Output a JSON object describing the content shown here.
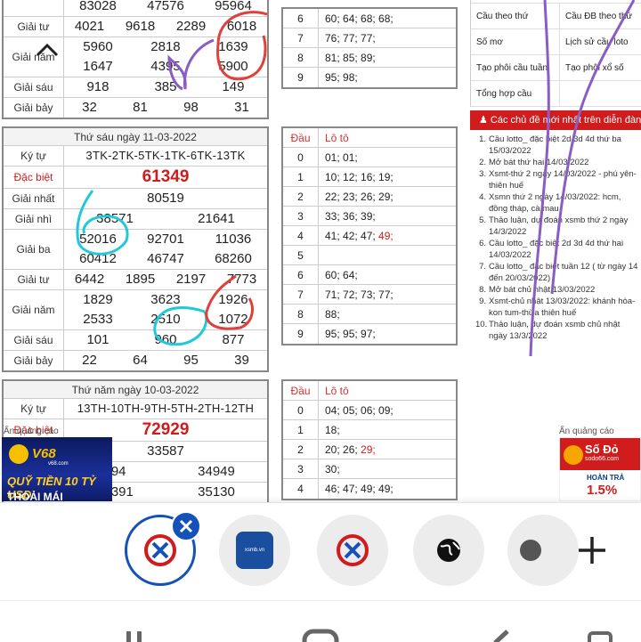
{
  "table1": {
    "rows": [
      {
        "label": "",
        "nums": [
          "83028",
          "47576",
          "95964"
        ]
      },
      {
        "label": "Giải tư",
        "nums": [
          "4021",
          "9618",
          "2289",
          "6018"
        ]
      },
      {
        "label": "Giải năm",
        "nums": [
          "5960",
          "2818",
          "1639",
          "1647",
          "4395",
          "5900"
        ]
      },
      {
        "label": "Giải sáu",
        "nums": [
          "918",
          "385",
          "149"
        ]
      },
      {
        "label": "Giải bảy",
        "nums": [
          "32",
          "81",
          "98",
          "31"
        ]
      }
    ]
  },
  "loto1": {
    "rows": [
      {
        "dau": "6",
        "lt": "60; 64; 68; 68;"
      },
      {
        "dau": "7",
        "lt": "76; 77; 77;"
      },
      {
        "dau": "8",
        "lt": "81; 85; 89;"
      },
      {
        "dau": "9",
        "lt": "95; 98;"
      }
    ]
  },
  "table2": {
    "caption": "Thứ sáu ngày 11-03-2022",
    "ky_tu_label": "Ký tự",
    "ky_tu": "3TK-2TK-5TK-1TK-6TK-13TK",
    "db_label": "Đặc biệt",
    "db": "61349",
    "g1_label": "Giải nhất",
    "g1": "80519",
    "g2_label": "Giải nhì",
    "g2": [
      "38571",
      "21641"
    ],
    "g3_label": "Giải ba",
    "g3": [
      "52016",
      "92701",
      "11036",
      "60412",
      "46747",
      "68260"
    ],
    "g4_label": "Giải tư",
    "g4": [
      "6442",
      "1895",
      "2197",
      "7773"
    ],
    "g5_label": "Giải năm",
    "g5": [
      "1829",
      "3623",
      "1926",
      "2533",
      "2510",
      "1072"
    ],
    "g6_label": "Giải sáu",
    "g6": [
      "101",
      "960",
      "877"
    ],
    "g7_label": "Giải bảy",
    "g7": [
      "22",
      "64",
      "95",
      "39"
    ]
  },
  "loto2": {
    "head_dau": "Đầu",
    "head_lt": "Lô tô",
    "rows": [
      {
        "dau": "0",
        "lt": "01; 01;",
        "red": ""
      },
      {
        "dau": "1",
        "lt": "10; 12; 16; 19;",
        "red": ""
      },
      {
        "dau": "2",
        "lt": "22; 23; 26; 29;",
        "red": ""
      },
      {
        "dau": "3",
        "lt": "33; 36; 39;",
        "red": ""
      },
      {
        "dau": "4",
        "lt": "41; 42; 47; ",
        "red": "49;"
      },
      {
        "dau": "5",
        "lt": "",
        "red": ""
      },
      {
        "dau": "6",
        "lt": "60; 64;",
        "red": ""
      },
      {
        "dau": "7",
        "lt": "71; 72; 73; 77;",
        "red": ""
      },
      {
        "dau": "8",
        "lt": "88;",
        "red": ""
      },
      {
        "dau": "9",
        "lt": "95; 95; 97;",
        "red": ""
      }
    ]
  },
  "table3": {
    "caption": "Thứ năm ngày 10-03-2022",
    "ky_tu_label": "Ký tự",
    "ky_tu": "13TH-10TH-9TH-5TH-2TH-12TH",
    "db_label": "Đặc biệt",
    "db": "72929",
    "g1": "33587",
    "g2": [
      "094",
      "34949"
    ],
    "g3": [
      "59391",
      "35130"
    ]
  },
  "loto3": {
    "head_dau": "Đầu",
    "head_lt": "Lô tô",
    "rows": [
      {
        "dau": "0",
        "lt": "04; 05; 06; 09;",
        "red": ""
      },
      {
        "dau": "1",
        "lt": "18;",
        "red": ""
      },
      {
        "dau": "2",
        "lt": "20; 26; ",
        "red": "29;"
      },
      {
        "dau": "3",
        "lt": "30;",
        "red": ""
      },
      {
        "dau": "4",
        "lt": "46; 47; 49; 49;",
        "red": ""
      }
    ]
  },
  "links": [
    [
      "Cầu theo thứ",
      "Cầu ĐB theo thứ"
    ],
    [
      "Số mơ",
      "Lịch sử cầu loto"
    ],
    [
      "Tạo phôi cầu tuần",
      "Tạo phôi xổ số"
    ],
    [
      "Tổng hợp cầu",
      ""
    ]
  ],
  "news": {
    "header": "Các chủ đề mới nhất trên diễn đàn",
    "items": [
      "Cầu lotto_ đặc biệt 2d 3d 4d thứ ba 15/03/2022",
      "Mở bát thứ hai 14/03/2022",
      "Xsmt-thứ 2 ngày 14/03/2022 - phú yên-thiên huế",
      "Xsmn thứ 2 ngày 14/03/2022: hcm, đồng tháp, cà mau",
      "Thảo luận, dự đoán xsmb thứ 2 ngày 14/3/2022",
      "Cầu lotto_ đặc biệt 2d 3d 4d thứ hai 14/03/2022",
      "Cầu lotto_ đặc biệt tuần 12 ( từ ngày 14 đến 20/03/2022)",
      "Mở bát chủ nhật 13/03/2022",
      "Xsmt-chủ nhật 13/03/2022: khánh hòa-kon tum-thừa thiên huế",
      "Thảo luận, dự đoán xsmb chủ nhật ngày 13/3/2022"
    ]
  },
  "ads": {
    "label_left": "Ẩn quảng cáo",
    "label_right": "Ẩn quảng cáo",
    "left_brand": "V68",
    "left_domain": "v68.com",
    "left_line1": "QUỸ TIỀN 10 TỶ USD",
    "left_line2": "THOẢI MÁI",
    "right_brand": "Số Đỏ",
    "right_domain": "sodo66.com",
    "right_line1": "HOÀN TRẢ",
    "right_line2": "1.5%"
  },
  "tabbar": {
    "second_tab_text": "xsmb.vn"
  },
  "colors": {
    "red": "#d01c1c",
    "tab_blue": "#1451b8"
  }
}
